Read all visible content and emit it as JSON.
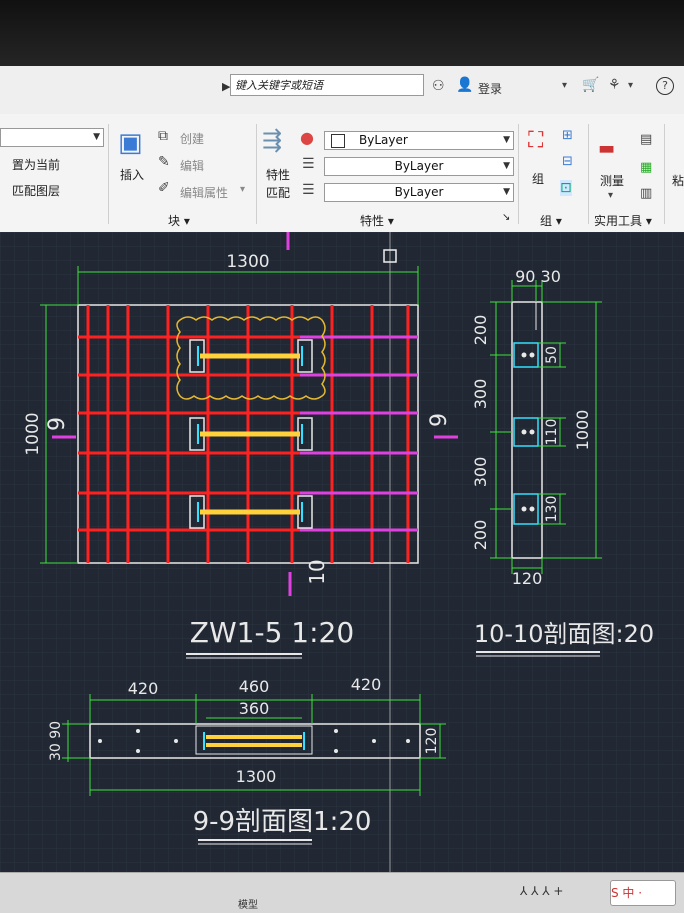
{
  "topbar": {
    "search_placeholder": "键入关键字或短语",
    "login_label": "登录",
    "help_icon": "?",
    "cart_icon": "cart-icon",
    "binoculars_icon": "binoculars-icon"
  },
  "ribbon": {
    "left_combo_value": "",
    "left_items": {
      "set_current": "置为当前",
      "match_layer": "匹配图层"
    },
    "block_panel": {
      "insert": "插入",
      "create": "创建",
      "edit": "编辑",
      "edit_attrs": "编辑属性",
      "edit_attrs_arrow": "▾",
      "panel_label": "块 ▾"
    },
    "properties_panel": {
      "match_props": "特性\n匹配",
      "match_props_line1": "特性",
      "match_props_line2": "匹配",
      "color_combo": "ByLayer",
      "linetype_combo": "ByLayer",
      "lineweight_combo": "ByLayer",
      "panel_label": "特性 ▾",
      "panel_launcher": "↘"
    },
    "group_panel": {
      "group": "组",
      "panel_label": "组 ▾"
    },
    "utilities_panel": {
      "measure": "测量",
      "panel_label": "实用工具 ▾"
    },
    "cut_label": "粘"
  },
  "drawing": {
    "main_view": {
      "title": "ZW1-5  1:20",
      "dim_top": "1300",
      "dim_left": "1000",
      "section_left": "9",
      "section_right": "9",
      "section_bottom": "10"
    },
    "section_10": {
      "title": "10-10剖面图:20",
      "dim_top": "90 30",
      "dims_left": [
        "200",
        "300",
        "300",
        "200"
      ],
      "dims_right": [
        "50",
        "110",
        "130"
      ],
      "dim_total": "1000",
      "dim_bottom": "120"
    },
    "section_9": {
      "title": "9-9剖面图1:20",
      "dims_top": [
        "420",
        "460",
        "420"
      ],
      "dim_inner": "360",
      "dim_left": "30 90",
      "dim_right": "120",
      "dim_bottom": "1300"
    }
  },
  "status": {
    "model_tab": "模型",
    "ime": "S 中 ·",
    "right_icons": "⅄ ⅄ ⅄ +"
  },
  "colors": {
    "canvas_bg": "#212833",
    "rebar_red": "#ff2020",
    "rebar_magenta": "#e040e0",
    "dim_green": "#3ee03e",
    "plate_yellow": "#ffd23c",
    "cloud_yellow": "#e6b830",
    "outline_white": "#e8e8e8"
  }
}
